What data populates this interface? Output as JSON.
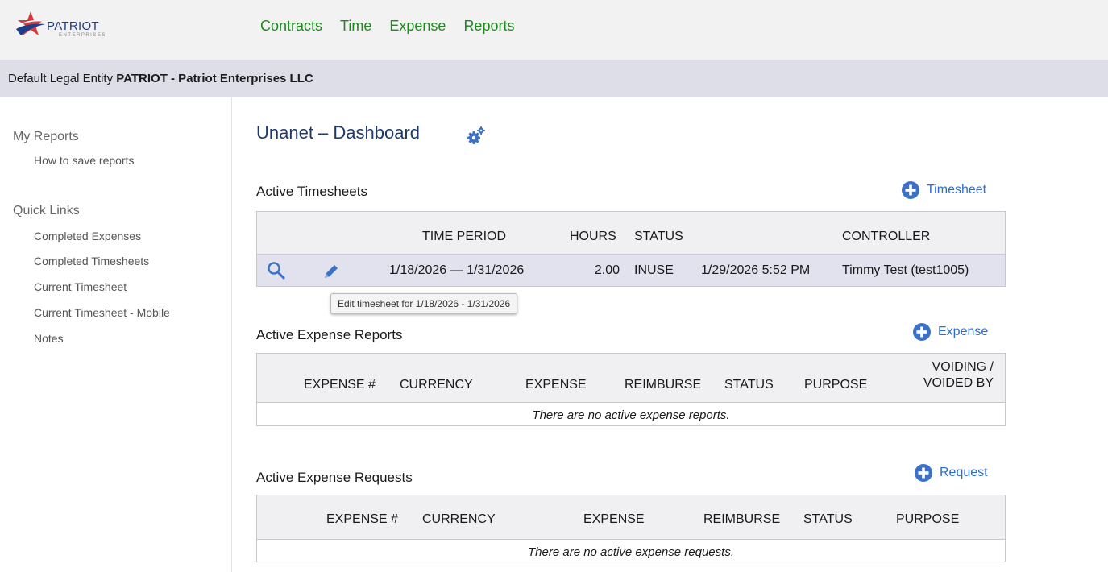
{
  "logo": {
    "name": "PATRIOT",
    "sub": "ENTERPRISES"
  },
  "nav": [
    "Contracts",
    "Time",
    "Expense",
    "Reports"
  ],
  "entity": {
    "label": "Default Legal Entity",
    "name": "PATRIOT - Patriot Enterprises LLC"
  },
  "sidebar": {
    "my_reports": "My Reports",
    "my_reports_items": [
      "How to save reports"
    ],
    "quick_links": "Quick Links",
    "quick_links_items": [
      "Completed Expenses",
      "Completed Timesheets",
      "Current Timesheet",
      "Current Timesheet - Mobile",
      "Notes"
    ]
  },
  "main": {
    "title": "Unanet – Dashboard",
    "timesheets": {
      "title": "Active Timesheets",
      "add_label": "Timesheet",
      "headers": {
        "time_period": "TIME PERIOD",
        "hours": "HOURS",
        "status": "STATUS",
        "controller": "CONTROLLER"
      },
      "rows": [
        {
          "period": "1/18/2026 — 1/31/2026",
          "hours": "2.00",
          "status": "INUSE",
          "date": "1/29/2026 5:52 PM",
          "controller": "Timmy Test (test1005)"
        }
      ],
      "tooltip": "Edit timesheet for 1/18/2026 - 1/31/2026"
    },
    "expense_reports": {
      "title": "Active Expense Reports",
      "add_label": "Expense",
      "headers": {
        "expense_no": "EXPENSE #",
        "currency": "CURRENCY",
        "expense": "EXPENSE",
        "reimburse": "REIMBURSE",
        "status": "STATUS",
        "purpose": "PURPOSE",
        "voiding_1": "VOIDING /",
        "voiding_2": "VOIDED BY"
      },
      "empty": "There are no active expense reports."
    },
    "expense_requests": {
      "title": "Active Expense Requests",
      "add_label": "Request",
      "headers": {
        "expense_no": "EXPENSE #",
        "currency": "CURRENCY",
        "expense": "EXPENSE",
        "reimburse": "REIMBURSE",
        "status": "STATUS",
        "purpose": "PURPOSE"
      },
      "empty": "There are no active expense requests."
    }
  },
  "colors": {
    "nav_green": "#1d8a1d",
    "title_blue": "#1e3a68",
    "link_blue": "#2b6ed0",
    "entity_bar": "#dedee8",
    "row_highlight": "#e2e2ee"
  }
}
